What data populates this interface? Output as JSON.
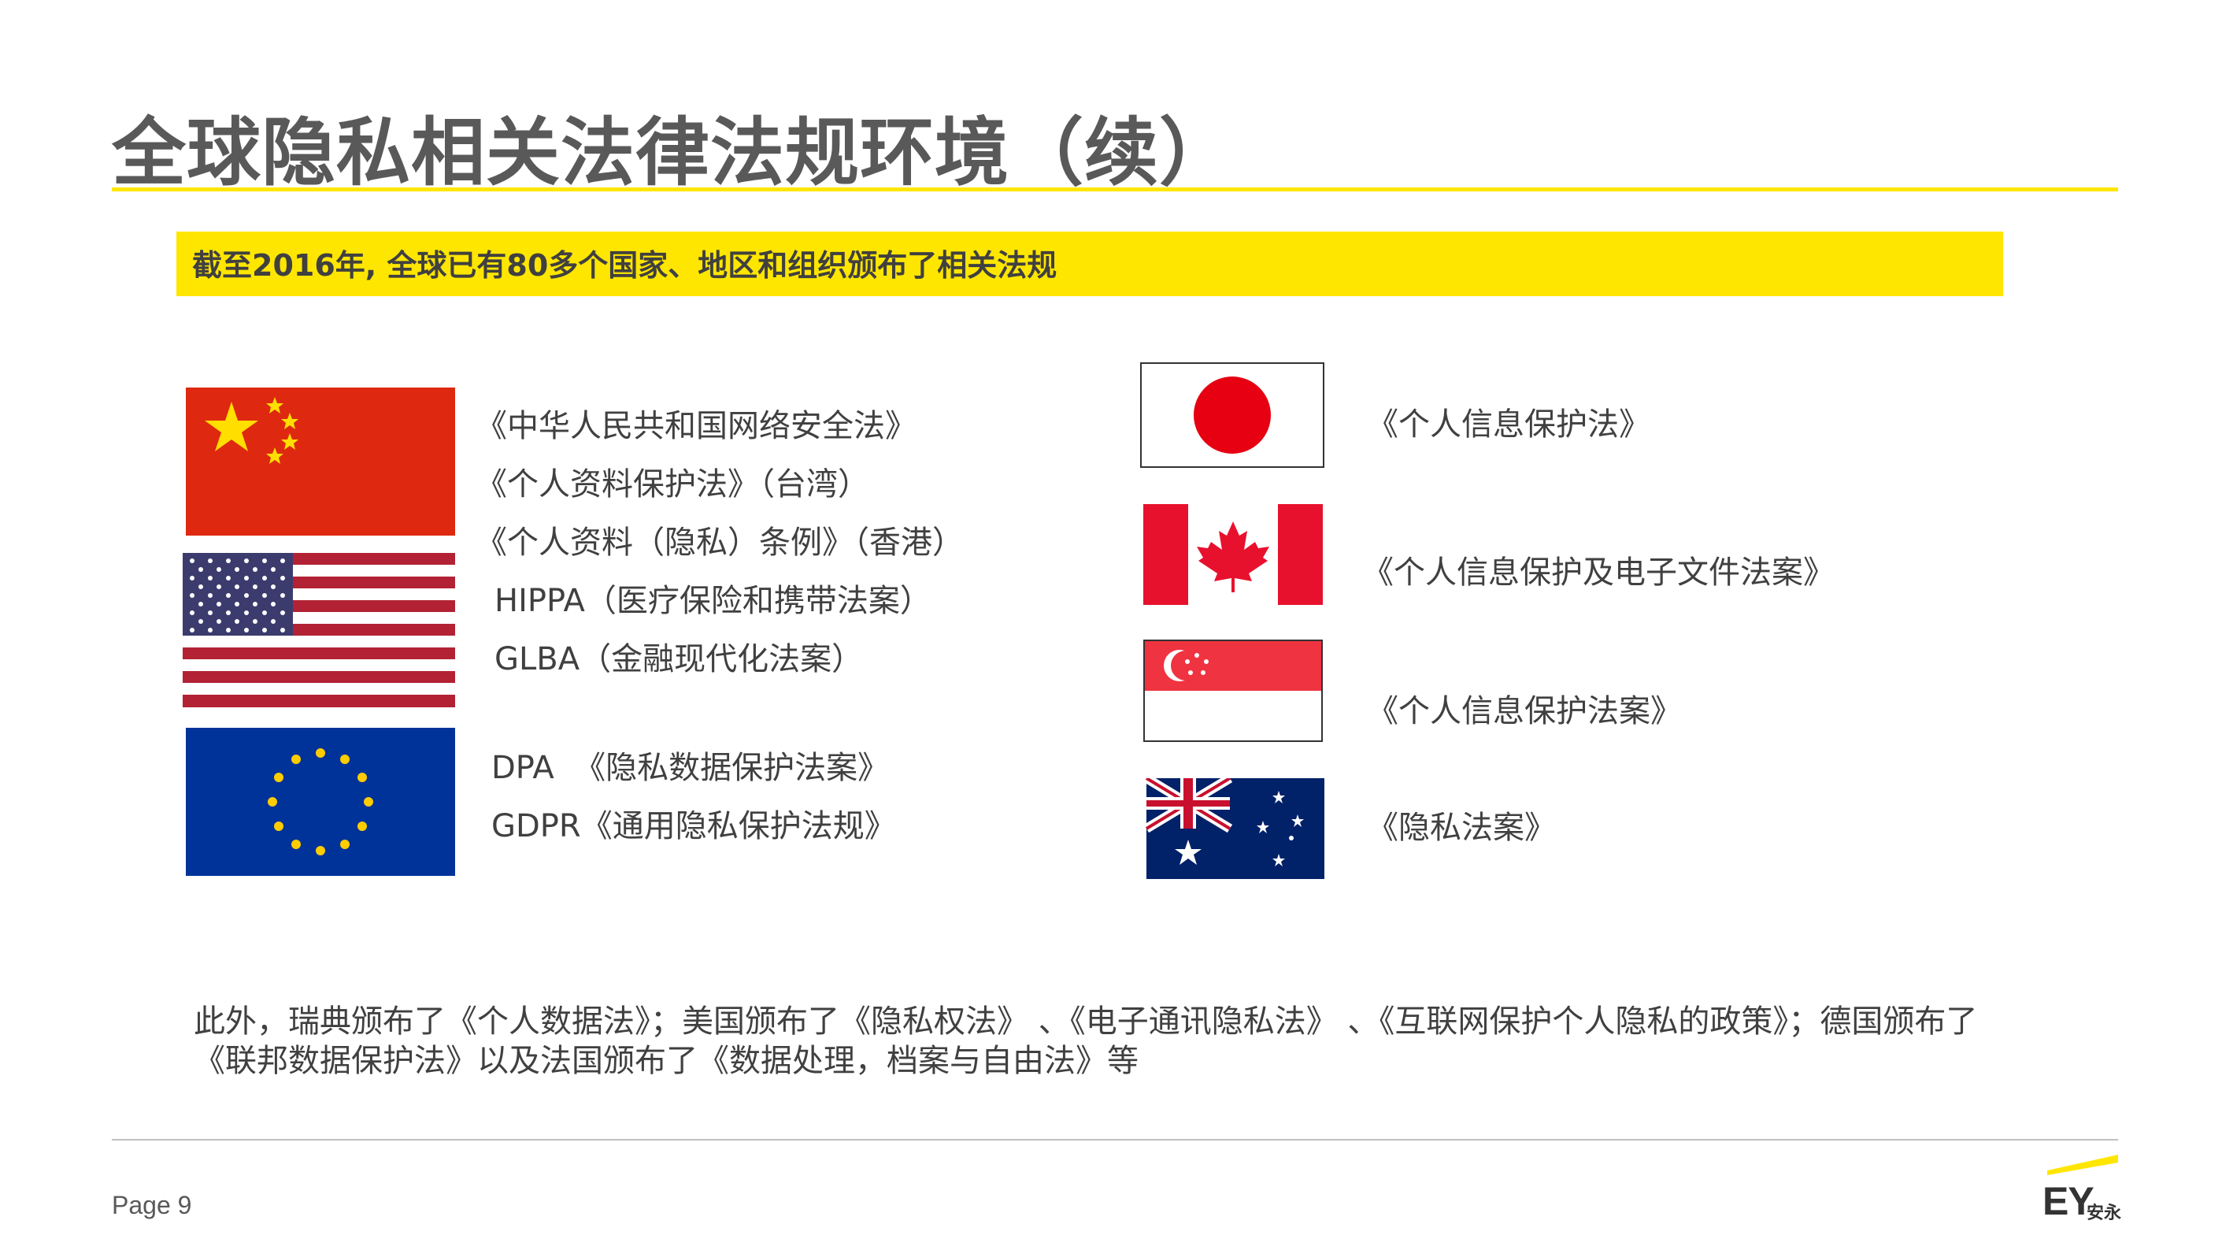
{
  "title": "全球隐私相关法律法规环境（续）",
  "banner": "截至2016年, 全球已有80多个国家、地区和组织颁布了相关法规",
  "left_laws": [
    "《中华人民共和国网络安全法》",
    "《个人资料保护法》（台湾）",
    "《个人资料（隐私）条例》（香港）",
    "HIPPA（医疗保险和携带法案）",
    "GLBA（金融现代化法案）",
    "DPA  《隐私数据保护法案》",
    "GDPR《通用隐私保护法规》"
  ],
  "right_laws": [
    "《个人信息保护法》",
    "《个人信息保护及电子文件法案》",
    "《个人信息保护法案》",
    "《隐私法案》"
  ],
  "footnote": "此外，瑞典颁布了《个人数据法》；美国颁布了《隐私权法》 、《电子通讯隐私法》 、《互联网保护个人隐私的政策》；德国颁布了《联邦数据保护法》以及法国颁布了《数据处理，档案与自由法》等",
  "footer": {
    "page_label": "Page 9",
    "logo_letters": "EY",
    "logo_cn": "安永"
  },
  "colors": {
    "accent_yellow": "#ffe600",
    "title_gray": "#595959",
    "body_text": "#404040"
  }
}
